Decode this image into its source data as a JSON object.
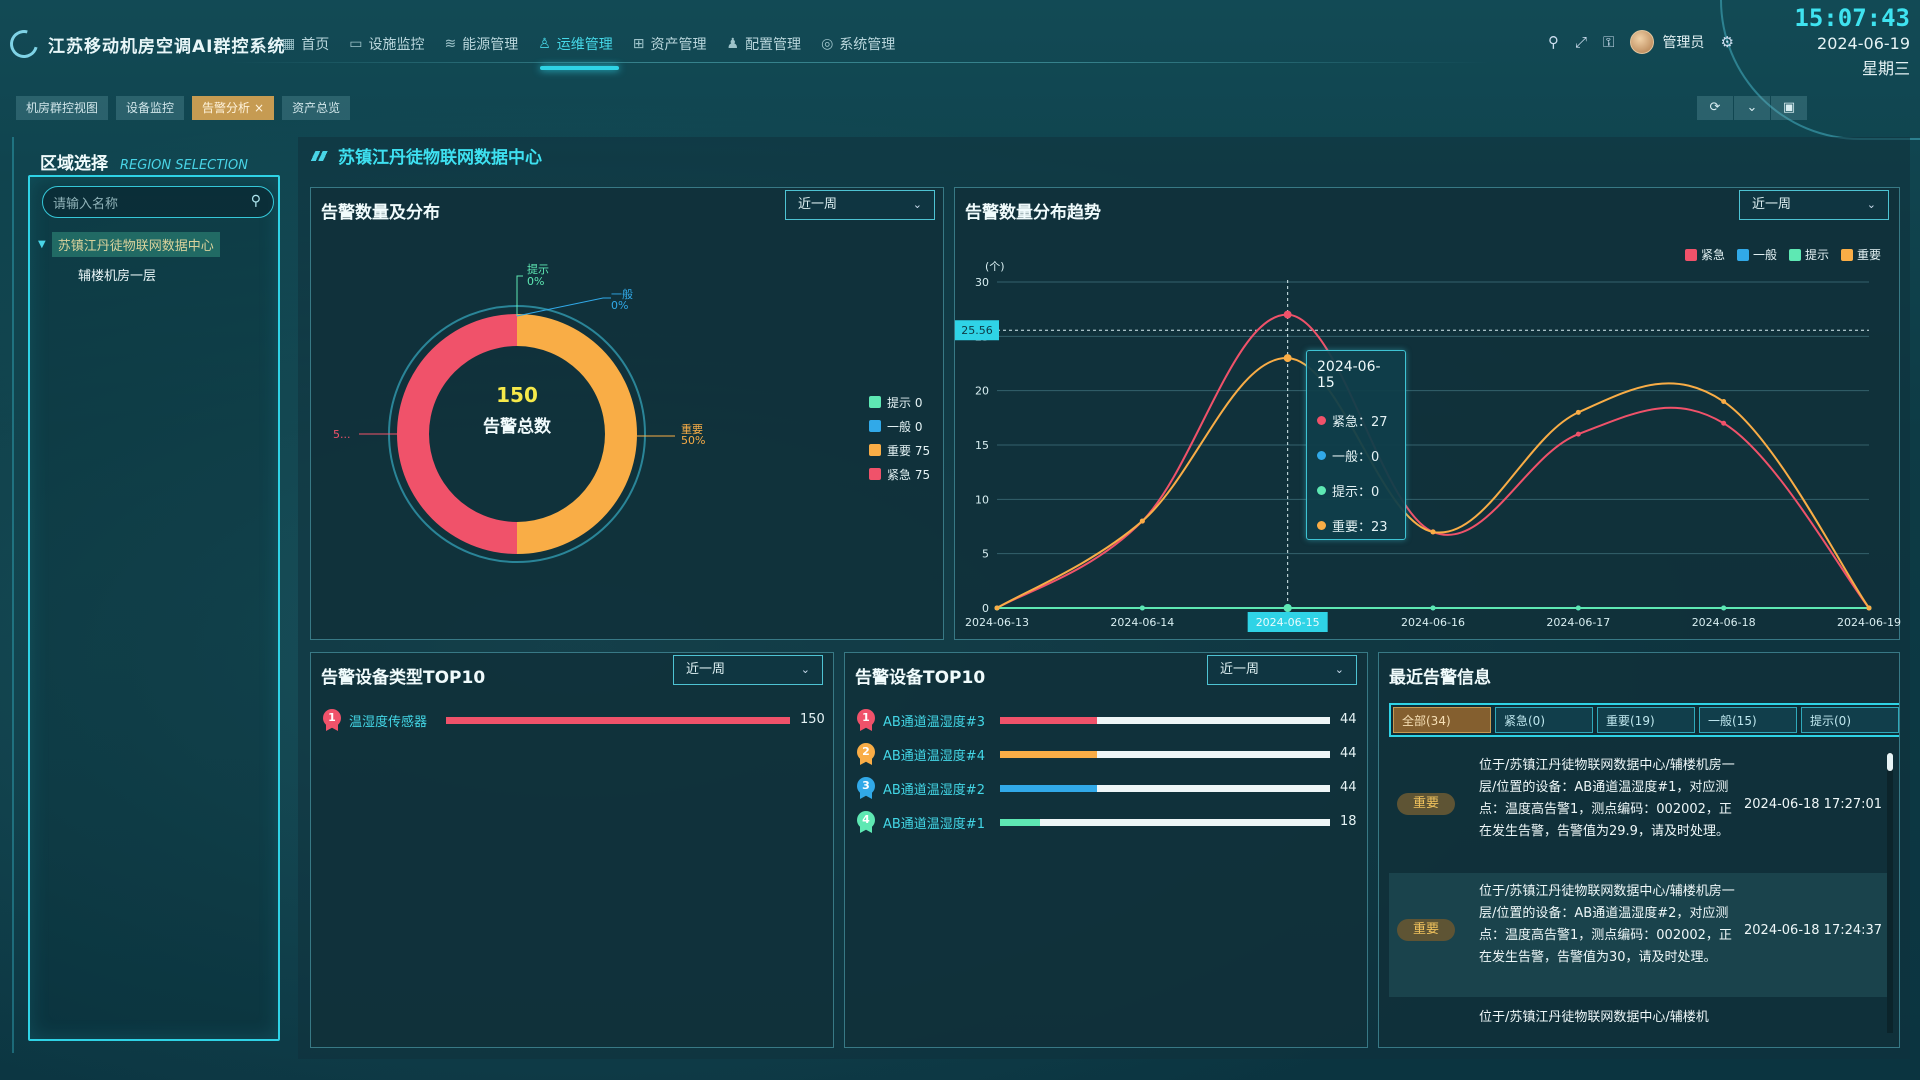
{
  "app": {
    "title": "江苏移动机房空调AI群控系统"
  },
  "nav": [
    {
      "label": "首页",
      "icon": "grid-icon",
      "glyph": "▦",
      "active": false
    },
    {
      "label": "设施监控",
      "icon": "monitor-icon",
      "glyph": "▭",
      "active": false
    },
    {
      "label": "能源管理",
      "icon": "energy-icon",
      "glyph": "≋",
      "active": false
    },
    {
      "label": "运维管理",
      "icon": "ops-user-icon",
      "glyph": "♙",
      "active": true
    },
    {
      "label": "资产管理",
      "icon": "asset-grid-icon",
      "glyph": "⊞",
      "active": false
    },
    {
      "label": "配置管理",
      "icon": "config-user-icon",
      "glyph": "♟",
      "active": false
    },
    {
      "label": "系统管理",
      "icon": "system-gear-icon",
      "glyph": "◎",
      "active": false
    }
  ],
  "header_tools": {
    "user": "管理员"
  },
  "clock": {
    "time": "15:07:43",
    "date": "2024-06-19",
    "weekday": "星期三"
  },
  "tabs": [
    {
      "label": "机房群控视图",
      "active": false
    },
    {
      "label": "设备监控",
      "active": false
    },
    {
      "label": "告警分析",
      "active": true,
      "close": "×"
    },
    {
      "label": "资产总览",
      "active": false
    }
  ],
  "region": {
    "title_cn": "区域选择",
    "title_en": "REGION SELECTION",
    "search_placeholder": "请输入名称",
    "tree": {
      "root": "苏镇江丹徒物联网数据中心",
      "child": "辅楼机房一层"
    }
  },
  "main": {
    "title": "苏镇江丹徒物联网数据中心"
  },
  "colors": {
    "urgent": "#f0526a",
    "general": "#31a9e8",
    "hint": "#5ee8b3",
    "important": "#f9ad46"
  },
  "pie_panel": {
    "title": "告警数量及分布",
    "select": "近一周",
    "total_value": "150",
    "total_label": "告警总数",
    "outer_labels": {
      "hint": "提示",
      "hint_pct": "0%",
      "general": "一般",
      "general_pct": "0%",
      "important": "重要",
      "important_pct": "50%",
      "urgent_trunc": "5..."
    },
    "legend": [
      {
        "label": "提示 0",
        "key": "hint"
      },
      {
        "label": "一般 0",
        "key": "general"
      },
      {
        "label": "重要 75",
        "key": "important"
      },
      {
        "label": "紧急 75",
        "key": "urgent"
      }
    ]
  },
  "trend_panel": {
    "title": "告警数量分布趋势",
    "select": "近一周",
    "legend": [
      {
        "label": "紧急",
        "key": "urgent"
      },
      {
        "label": "一般",
        "key": "general"
      },
      {
        "label": "提示",
        "key": "hint"
      },
      {
        "label": "重要",
        "key": "important"
      }
    ],
    "crosshair_label": "25.56",
    "tooltip": {
      "date": "2024-06-15",
      "rows": [
        {
          "label": "紧急：27",
          "key": "urgent"
        },
        {
          "label": "一般：0",
          "key": "general"
        },
        {
          "label": "提示：0",
          "key": "hint"
        },
        {
          "label": "重要：23",
          "key": "important"
        }
      ]
    }
  },
  "chart_data": [
    {
      "type": "pie",
      "title": "告警数量及分布",
      "categories": [
        "提示",
        "一般",
        "重要",
        "紧急"
      ],
      "values": [
        0,
        0,
        75,
        75
      ],
      "center_text": "150 告警总数"
    },
    {
      "type": "line",
      "title": "告警数量分布趋势",
      "ylabel": "(个)",
      "ylim": [
        0,
        30
      ],
      "yticks": [
        0,
        5,
        10,
        15,
        20,
        25,
        30
      ],
      "x": [
        "2024-06-13",
        "2024-06-14",
        "2024-06-15",
        "2024-06-16",
        "2024-06-17",
        "2024-06-18",
        "2024-06-19"
      ],
      "series": [
        {
          "name": "紧急",
          "key": "urgent",
          "values": [
            0,
            8,
            27,
            7,
            16,
            17,
            0
          ]
        },
        {
          "name": "一般",
          "key": "general",
          "values": [
            0,
            0,
            0,
            0,
            0,
            0,
            0
          ]
        },
        {
          "name": "提示",
          "key": "hint",
          "values": [
            0,
            0,
            0,
            0,
            0,
            0,
            0
          ]
        },
        {
          "name": "重要",
          "key": "important",
          "values": [
            0,
            8,
            23,
            7,
            18,
            19,
            0
          ]
        }
      ],
      "highlight_x": "2024-06-15",
      "grid": true,
      "legend": "top-right"
    },
    {
      "type": "bar",
      "title": "告警设备类型TOP10",
      "categories": [
        "温湿度传感器"
      ],
      "values": [
        150
      ],
      "xlim": [
        0,
        150
      ]
    },
    {
      "type": "bar",
      "title": "告警设备TOP10",
      "categories": [
        "AB通道温湿度#3",
        "AB通道温湿度#4",
        "AB通道温湿度#2",
        "AB通道温湿度#1"
      ],
      "values": [
        44,
        44,
        44,
        18
      ],
      "xlim": [
        0,
        150
      ]
    }
  ],
  "type_top10": {
    "title": "告警设备类型TOP10",
    "select": "近一周",
    "rows": [
      {
        "rank": "1",
        "name": "温湿度传感器",
        "value": "150",
        "fraction": 1.0,
        "color_key": "urgent",
        "medal": "#f0526a"
      }
    ]
  },
  "device_top10": {
    "title": "告警设备TOP10",
    "select": "近一周",
    "rows": [
      {
        "rank": "1",
        "name": "AB通道温湿度#3",
        "value": "44",
        "fraction": 0.293,
        "color_key": "urgent",
        "medal": "#f0526a"
      },
      {
        "rank": "2",
        "name": "AB通道温湿度#4",
        "value": "44",
        "fraction": 0.293,
        "color_key": "important",
        "medal": "#f9ad46"
      },
      {
        "rank": "3",
        "name": "AB通道温湿度#2",
        "value": "44",
        "fraction": 0.293,
        "color_key": "general",
        "medal": "#31a9e8"
      },
      {
        "rank": "4",
        "name": "AB通道温湿度#1",
        "value": "18",
        "fraction": 0.12,
        "color_key": "hint",
        "medal": "#5ee8b3"
      }
    ]
  },
  "alerts": {
    "title": "最近告警信息",
    "filters": [
      {
        "label": "全部(34)",
        "active": true
      },
      {
        "label": "紧急(0)",
        "active": false
      },
      {
        "label": "重要(19)",
        "active": false
      },
      {
        "label": "一般(15)",
        "active": false
      },
      {
        "label": "提示(0)",
        "active": false
      }
    ],
    "items": [
      {
        "level": "重要",
        "message": "位于/苏镇江丹徒物联网数据中心/辅楼机房一层/位置的设备：AB通道温湿度#1，对应测点：温度高告警1，测点编码：002002，正在发生告警，告警值为29.9，请及时处理。",
        "time": "2024-06-18 17:27:01"
      },
      {
        "level": "重要",
        "message": "位于/苏镇江丹徒物联网数据中心/辅楼机房一层/位置的设备：AB通道温湿度#2，对应测点：温度高告警1，测点编码：002002，正在发生告警，告警值为30，请及时处理。",
        "time": "2024-06-18 17:24:37"
      },
      {
        "level": "",
        "message": "位于/苏镇江丹徒物联网数据中心/辅楼机",
        "time": ""
      }
    ]
  }
}
